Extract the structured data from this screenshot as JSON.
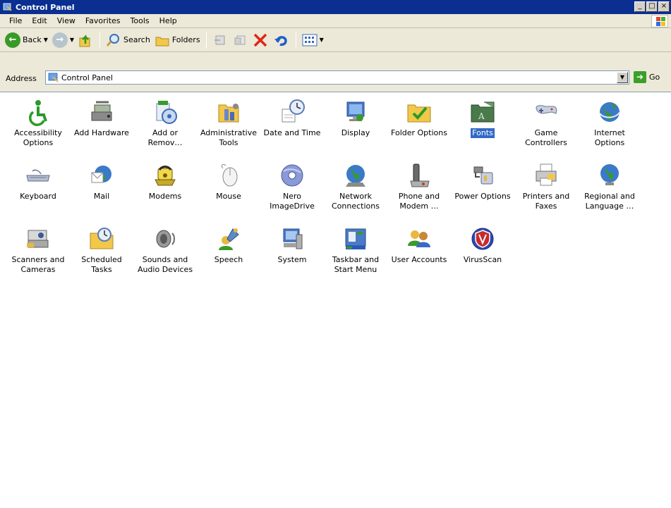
{
  "window": {
    "title": "Control Panel",
    "controls": [
      "_",
      "□",
      "×"
    ]
  },
  "menu": [
    "File",
    "Edit",
    "View",
    "Favorites",
    "Tools",
    "Help"
  ],
  "toolbar": {
    "back": "Back",
    "search": "Search",
    "folders": "Folders"
  },
  "address": {
    "label": "Address",
    "value": "Control Panel",
    "go": "Go"
  },
  "items": [
    {
      "label": "Accessibility Options",
      "icon": "accessibility-icon"
    },
    {
      "label": "Add Hardware",
      "icon": "add-hardware-icon"
    },
    {
      "label": "Add or Remov…",
      "icon": "add-remove-programs-icon"
    },
    {
      "label": "Administrative Tools",
      "icon": "administrative-tools-icon"
    },
    {
      "label": "Date and Time",
      "icon": "date-time-icon"
    },
    {
      "label": "Display",
      "icon": "display-icon"
    },
    {
      "label": "Folder Options",
      "icon": "folder-options-icon"
    },
    {
      "label": "Fonts",
      "icon": "fonts-icon",
      "selected": true
    },
    {
      "label": "Game Controllers",
      "icon": "game-controllers-icon"
    },
    {
      "label": "Internet Options",
      "icon": "internet-options-icon"
    },
    {
      "label": "Keyboard",
      "icon": "keyboard-icon"
    },
    {
      "label": "Mail",
      "icon": "mail-icon"
    },
    {
      "label": "Modems",
      "icon": "modems-icon"
    },
    {
      "label": "Mouse",
      "icon": "mouse-icon"
    },
    {
      "label": "Nero ImageDrive",
      "icon": "nero-imagedrive-icon"
    },
    {
      "label": "Network Connections",
      "icon": "network-connections-icon"
    },
    {
      "label": "Phone and Modem …",
      "icon": "phone-modem-icon"
    },
    {
      "label": "Power Options",
      "icon": "power-options-icon"
    },
    {
      "label": "Printers and Faxes",
      "icon": "printers-faxes-icon"
    },
    {
      "label": "Regional and Language …",
      "icon": "regional-language-icon"
    },
    {
      "label": "Scanners and Cameras",
      "icon": "scanners-cameras-icon"
    },
    {
      "label": "Scheduled Tasks",
      "icon": "scheduled-tasks-icon"
    },
    {
      "label": "Sounds and Audio Devices",
      "icon": "sounds-audio-icon"
    },
    {
      "label": "Speech",
      "icon": "speech-icon"
    },
    {
      "label": "System",
      "icon": "system-icon"
    },
    {
      "label": "Taskbar and Start Menu",
      "icon": "taskbar-start-menu-icon"
    },
    {
      "label": "User Accounts",
      "icon": "user-accounts-icon"
    },
    {
      "label": "VirusScan",
      "icon": "virusscan-icon"
    }
  ]
}
